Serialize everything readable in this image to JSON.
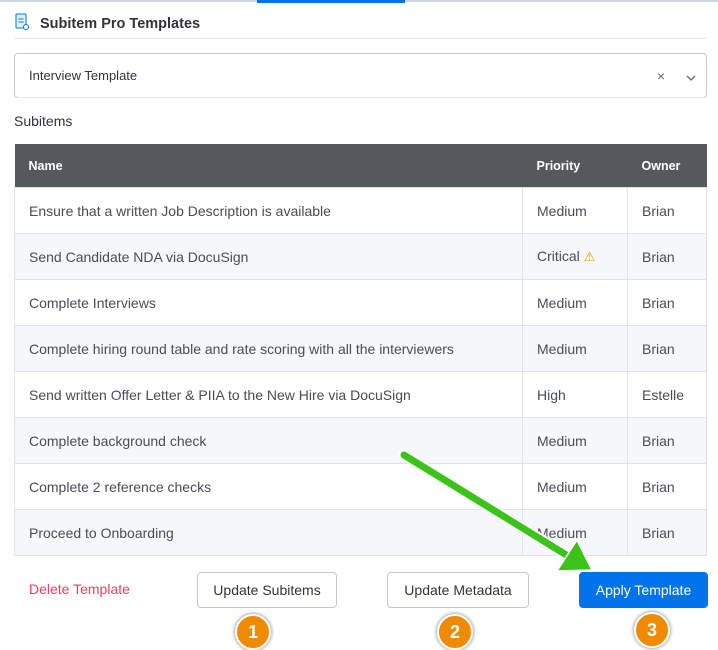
{
  "header": {
    "title": "Subitem Pro Templates",
    "icon": "document-icon"
  },
  "select": {
    "value": "Interview Template",
    "clear_icon": "×",
    "chevron_icon": "⌄"
  },
  "subitems_label": "Subitems",
  "table": {
    "columns": [
      "Name",
      "Priority",
      "Owner"
    ],
    "rows": [
      {
        "name": "Ensure that a written Job Description is available",
        "priority": "Medium",
        "owner": "Brian"
      },
      {
        "name": "Send Candidate NDA via DocuSign",
        "priority": "Critical",
        "owner": "Brian",
        "warning": "⚠"
      },
      {
        "name": "Complete Interviews",
        "priority": "Medium",
        "owner": "Brian"
      },
      {
        "name": "Complete hiring round table and rate scoring with all the interviewers",
        "priority": "Medium",
        "owner": "Brian"
      },
      {
        "name": "Send written Offer Letter & PIIA to the New Hire via DocuSign",
        "priority": "High",
        "owner": "Estelle"
      },
      {
        "name": "Complete background check",
        "priority": "Medium",
        "owner": "Brian"
      },
      {
        "name": "Complete 2 reference checks",
        "priority": "Medium",
        "owner": "Brian"
      },
      {
        "name": "Proceed to Onboarding",
        "priority": "Medium",
        "owner": "Brian"
      }
    ]
  },
  "actions": {
    "delete": "Delete Template",
    "update_subitems": "Update Subitems",
    "update_metadata": "Update Metadata",
    "apply": "Apply Template"
  },
  "badges": [
    "1",
    "2",
    "3"
  ],
  "colors": {
    "accent": "#0073ea",
    "danger": "#e2445c",
    "badge": "#f08a00",
    "arrow": "#3cc31a",
    "header_bg": "#55585d"
  }
}
